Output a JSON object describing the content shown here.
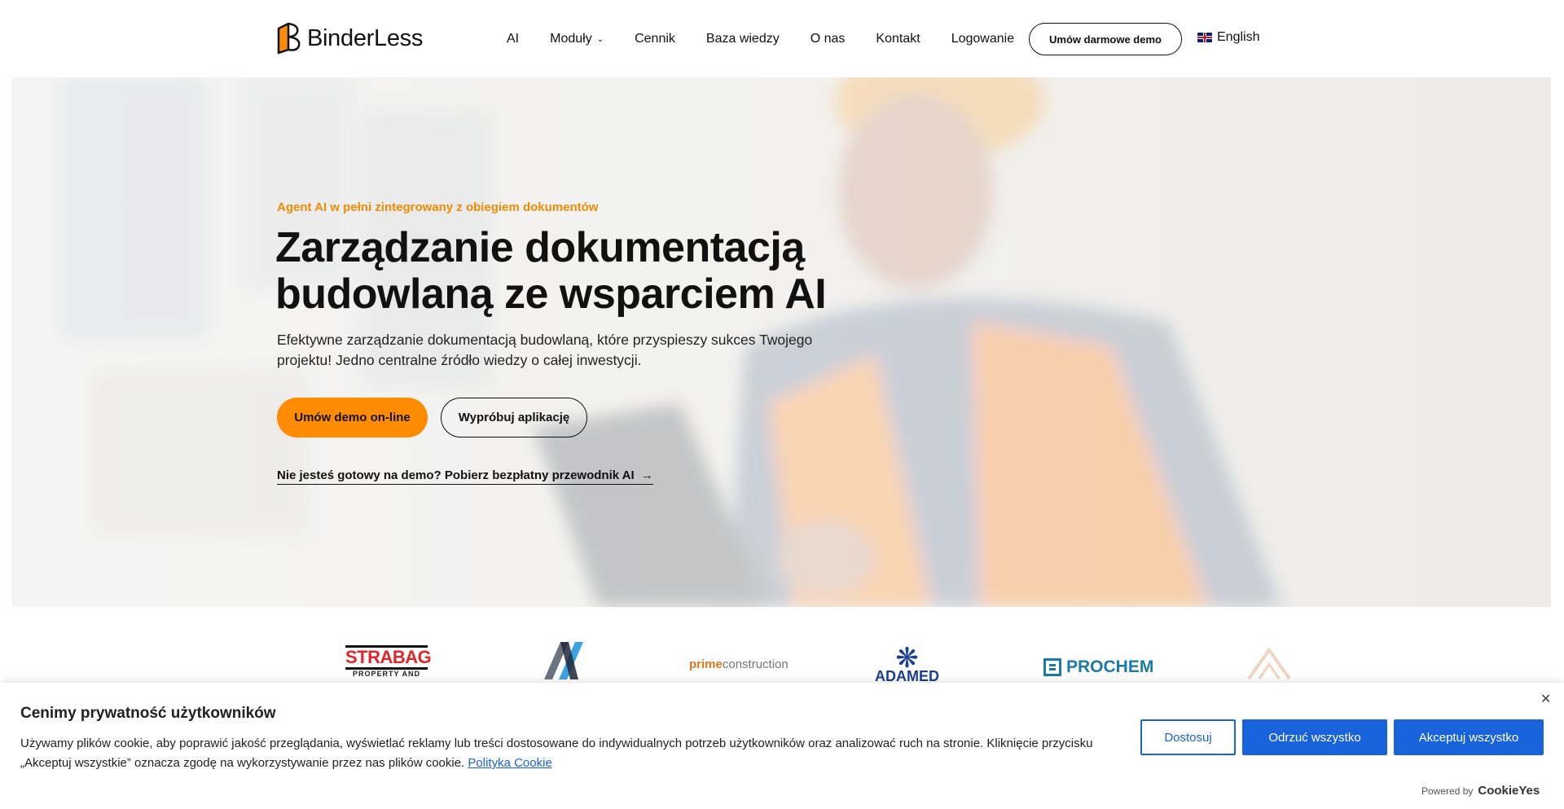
{
  "header": {
    "logo_text": "BinderLess",
    "nav": [
      {
        "label": "AI"
      },
      {
        "label": "Moduły",
        "has_dropdown": true
      },
      {
        "label": "Cennik"
      },
      {
        "label": "Baza wiedzy"
      },
      {
        "label": "O nas"
      },
      {
        "label": "Kontakt"
      },
      {
        "label": "Logowanie"
      }
    ],
    "demo_button": "Umów darmowe demo",
    "language": "English"
  },
  "hero": {
    "eyebrow": "Agent AI w pełni zintegrowany z obiegiem dokumentów",
    "headline_line1": "Zarządzanie dokumentacją",
    "headline_line2": "budowlaną ze wsparciem AI",
    "subtext": "Efektywne zarządzanie dokumentacją budowlaną, które przyspieszy sukces Twojego projektu! Jedno centralne źródło wiedzy o całej inwestycji.",
    "primary_button": "Umów demo on-line",
    "secondary_button": "Wypróbuj aplikację",
    "guide_link": "Nie jesteś gotowy na demo? Pobierz bezpłatny przewodnik AI"
  },
  "client_logos": {
    "strabag": "STRABAG",
    "strabag_sub": "PROPERTY AND",
    "prime_a": "prime",
    "prime_b": "construction",
    "adamed": "ADAMED",
    "prochem": "PROCHEM"
  },
  "cookie_banner": {
    "title": "Cenimy prywatność użytkowników",
    "text": "Używamy plików cookie, aby poprawić jakość przeglądania, wyświetlać reklamy lub treści dostosowane do indywidualnych potrzeb użytkowników oraz analizować ruch na stronie. Kliknięcie przycisku „Akceptuj wszystkie” oznacza zgodę na wykorzystywanie przez nas plików cookie.",
    "policy_link": "Polityka Cookie",
    "customize": "Dostosuj",
    "reject": "Odrzuć wszystko",
    "accept": "Akceptuj wszystko",
    "powered_by": "Powered by",
    "powered_brand": "CookieYes"
  },
  "colors": {
    "accent_orange": "#ff8c00",
    "cookie_blue": "#1863dc"
  }
}
